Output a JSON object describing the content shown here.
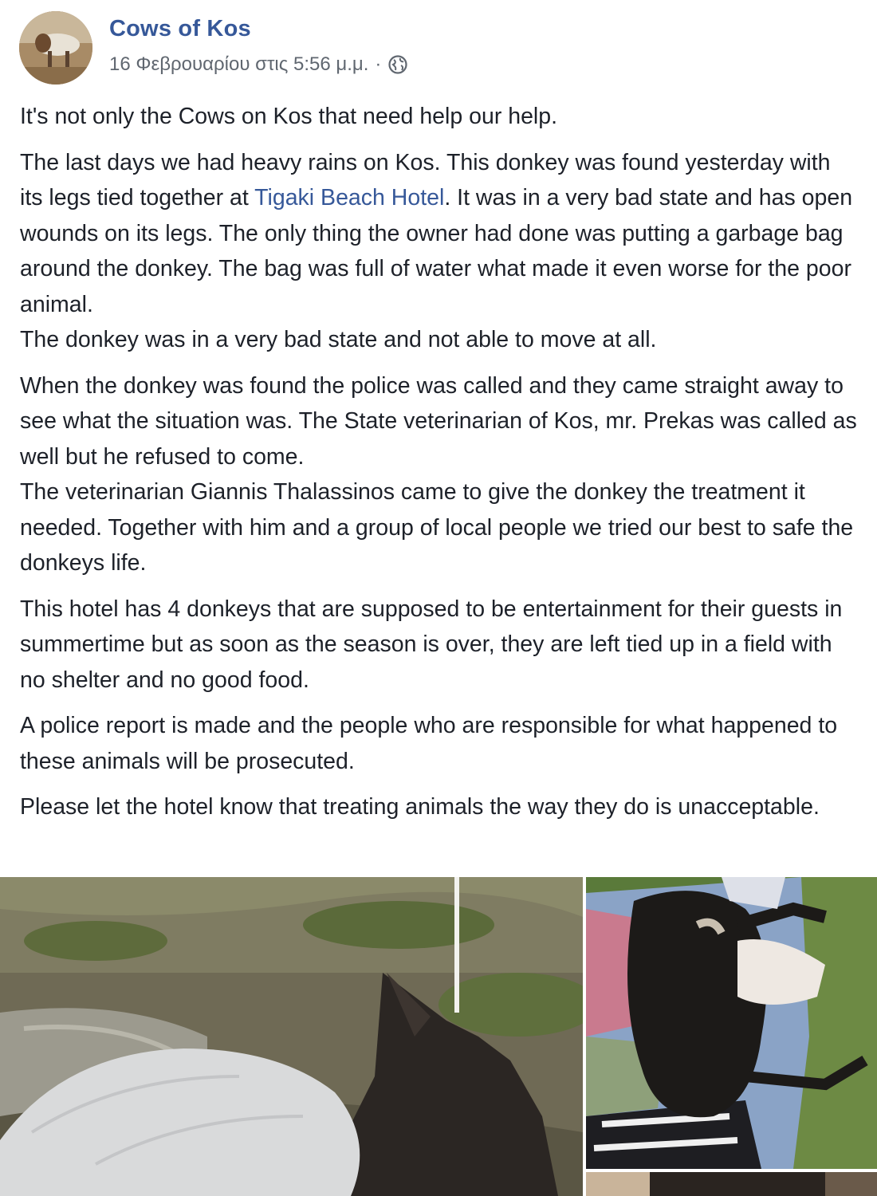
{
  "post": {
    "author": "Cows of Kos",
    "timestamp": "16 Φεβρουαρίου στις 5:56 μ.μ.",
    "separator": "·",
    "privacy_icon": "globe-icon",
    "paragraphs": [
      {
        "id": "p1",
        "text": "It's not only the Cows on Kos that need help our help."
      },
      {
        "id": "p2",
        "before": "The last days we had heavy rains on Kos. This donkey was found yesterday with its legs tied together at ",
        "link": "Tigaki Beach Hotel",
        "after": ". It was in a very bad state and has open wounds on its legs. The only thing the owner had done was putting a garbage bag around the donkey. The bag was full of water what made it even worse for the poor animal.",
        "line2": "The donkey was in a very bad state and not able to move at all."
      },
      {
        "id": "p3",
        "text": "When the donkey was found the police was called and they came straight away to see what the situation was. The State veterinarian of Kos, mr. Prekas was called as well but he refused to come.",
        "line2": "The veterinarian Giannis Thalassinos came to give the donkey the treatment it needed. Together with him and a group of local people we tried our best to safe the donkeys life."
      },
      {
        "id": "p4",
        "text": "This hotel has 4 donkeys that are supposed to be entertainment for their guests in summertime but as soon as the season is over, they are left tied up in a field with no shelter and no good food."
      },
      {
        "id": "p5",
        "text": "A police report is made and the people who are responsible for what happened to these animals will be prosecuted."
      },
      {
        "id": "p6",
        "text": "Please let the hotel know that treating animals the way they do is unacceptable."
      }
    ]
  },
  "colors": {
    "link": "#365899",
    "text": "#1d2129",
    "meta": "#606770"
  }
}
